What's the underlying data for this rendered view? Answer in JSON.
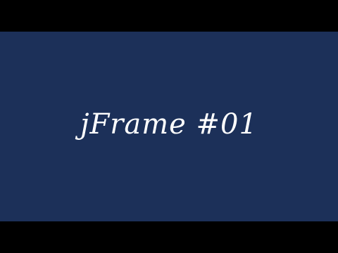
{
  "slide": {
    "title": "jFrame #01",
    "background_color": "#1c3059",
    "text_color": "#ffffff"
  },
  "letterbox_color": "#000000"
}
